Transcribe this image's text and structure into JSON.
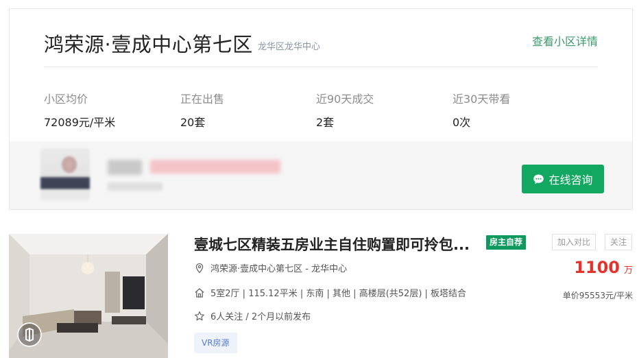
{
  "community": {
    "name": "鸿荣源·壹成中心第七区",
    "area": "龙华区龙华中心",
    "details_link": "查看小区详情",
    "stats": [
      {
        "label": "小区均价",
        "value": "72089元/平米"
      },
      {
        "label": "正在出售",
        "value": "20套"
      },
      {
        "label": "近90天成交",
        "value": "2套"
      },
      {
        "label": "近30天带看",
        "value": "0次"
      }
    ],
    "consult_button": "在线咨询"
  },
  "listing": {
    "title": "壹城七区精装五房业主自住购置即可拎包...",
    "owner_badge": "房主自荐",
    "compare_button": "加入对比",
    "follow_button": "关注",
    "location": "鸿荣源·壹成中心第七区 - 龙华中心",
    "specs": [
      "5室2厅",
      "115.12平米",
      "东南",
      "其他",
      "高楼层(共52层)",
      "板塔结合"
    ],
    "follow_info": "6人关注 / 2个月以前发布",
    "price": "1100",
    "price_unit": "万",
    "unit_price": "单价95553元/平米",
    "vr_tag": "VR房源"
  },
  "colors": {
    "accent_green": "#13a861",
    "link_green": "#3c9a6a",
    "price_red": "#e0342d",
    "vr_blue": "#5a7ccd"
  },
  "icons": {
    "consult": "chat-bubble-icon",
    "location": "map-pin-icon",
    "house": "house-icon",
    "star": "star-icon",
    "vr": "vr-camera-icon"
  }
}
